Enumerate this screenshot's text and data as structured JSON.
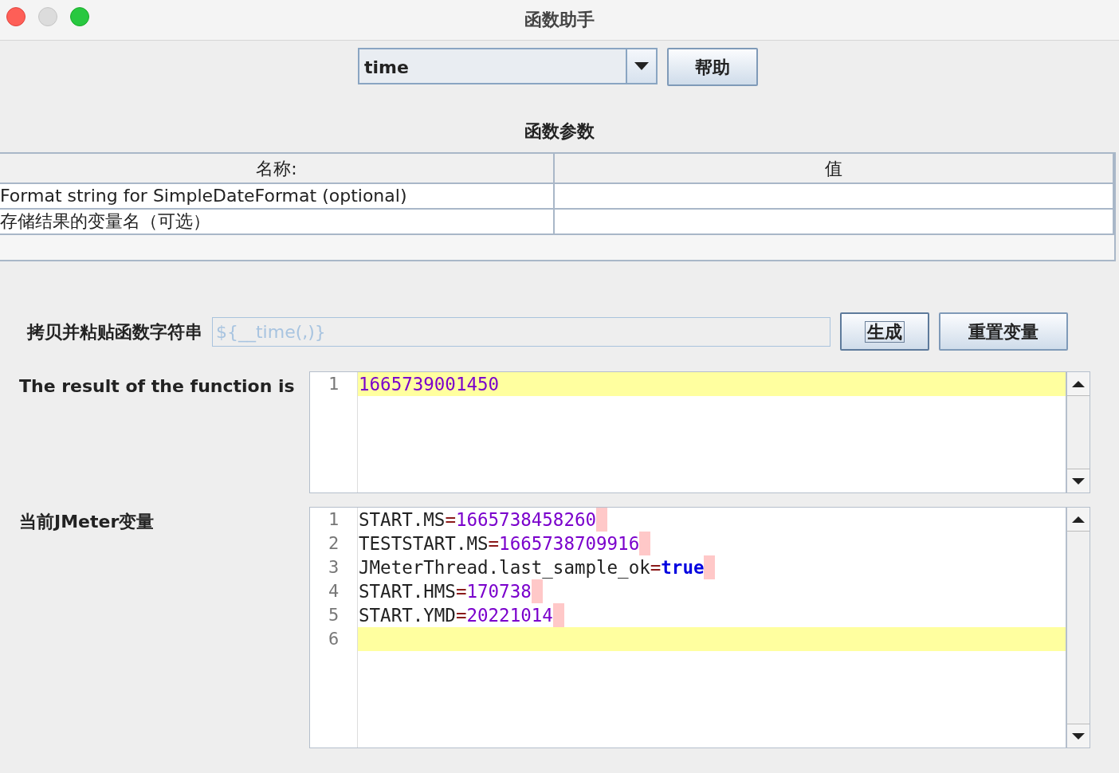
{
  "window": {
    "title": "函数助手"
  },
  "function_select": {
    "value": "time"
  },
  "help_button": {
    "label": "帮助"
  },
  "parameters": {
    "title": "函数参数",
    "columns": [
      "名称:",
      "值"
    ],
    "rows": [
      {
        "name": "Format string for SimpleDateFormat (optional)"
      },
      {
        "name": "存储结果的变量名（可选）"
      }
    ]
  },
  "function_string": {
    "label": "拷贝并粘贴函数字符串",
    "value": "${__time(,)}",
    "disabled": true
  },
  "buttons": [
    {
      "label": "生成",
      "focused": true
    },
    {
      "label": "重置变量",
      "focused": false
    }
  ],
  "result": {
    "label": "The result of the function is",
    "lines": [
      {
        "number": "1",
        "kind": "literal",
        "text": "1665739001450",
        "current": true
      }
    ]
  },
  "variables": {
    "label": "当前JMeter变量",
    "lines": [
      {
        "number": "1",
        "kind": "numeric",
        "key": "START.MS",
        "operator": "=",
        "value": "1665738458260",
        "current": false
      },
      {
        "number": "2",
        "kind": "numeric",
        "key": "TESTSTART.MS",
        "operator": "=",
        "value": "1665738709916",
        "current": false
      },
      {
        "number": "3",
        "kind": "boolean",
        "key": "JMeterThread.last_sample_ok",
        "operator": "=",
        "value": "true",
        "current": false
      },
      {
        "number": "4",
        "kind": "numeric",
        "key": "START.HMS",
        "operator": "=",
        "value": "170738",
        "current": false
      },
      {
        "number": "5",
        "kind": "numeric",
        "key": "START.YMD",
        "operator": "=",
        "value": "20221014",
        "current": false
      },
      {
        "number": "6",
        "kind": "empty",
        "current": true
      }
    ]
  }
}
